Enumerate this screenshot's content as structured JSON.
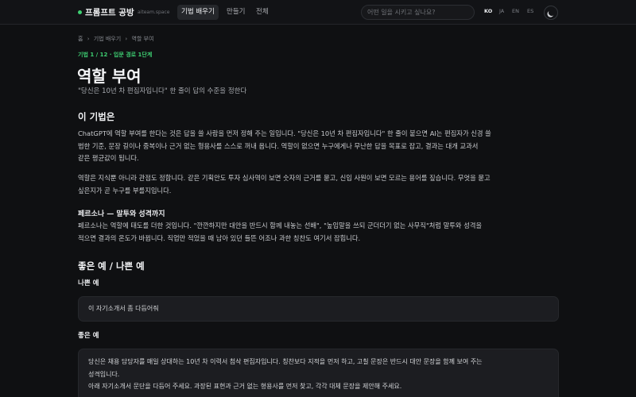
{
  "header": {
    "brand": "프롬프트 공방",
    "domain": "aiteam.space",
    "nav": [
      "기법 배우기",
      "만들기",
      "전체"
    ],
    "active_nav": "기법 배우기",
    "search_placeholder": "어떤 일을 시키고 싶나요?",
    "languages": [
      "KO",
      "JA",
      "EN",
      "ES"
    ],
    "active_language": "KO"
  },
  "breadcrumb": [
    "홈",
    "›",
    "기법 배우기",
    "›",
    "역할 부여"
  ],
  "meta": "기법 1 / 12 · 입문 경로 1단계",
  "title": "역할 부여",
  "subtitle": "\"당신은 10년 차 편집자입니다\" 한 줄이 답의 수준을 정한다",
  "section1": {
    "heading": "이 기법은",
    "para1": [
      "ChatGPT에 역할 부여를 한다는 것은 답을 쓸 사람을 먼저 정해 주는 일입니다. \"당신은 10년 차 편집자입니다\" 한 줄이 붙으면 AI는 편집자가 신경 쓸",
      "법한 기준, 문장 길이나 중복이나 근거 없는 형용사를 스스로 꺼내 옵니다. 역할이 없으면 누구에게나 무난한 답을 목표로 잡고, 결과는 대개 교과서",
      "같은 평균값이 됩니다."
    ],
    "para2": [
      "역할은 지식뿐 아니라 관점도 정합니다. 같은 기획안도 투자 심사역이 보면 숫자의 근거를 묻고, 신입 사원이 보면 모르는 용어를 짚습니다. 무엇을 묻고",
      "싶은지가 곧 누구를 부를지입니다."
    ],
    "subheading": "페르소나 — 말투와 성격까지",
    "para3": [
      "페르소나는 역할에 태도를 더한 것입니다. \"깐깐하지만 대안을 반드시 함께 내놓는 선배\", \"높임말을 쓰되 군더더기 없는 사무직\"처럼 말투와 성격을",
      "적으면 결과의 온도가 바뀝니다. 직업만 적었을 때 남아 있던 들뜬 어조나 과한 칭찬도 여기서 잡힙니다."
    ]
  },
  "section2": {
    "heading": "좋은 예 / 나쁜 예",
    "bad_label": "나쁜 예",
    "bad_example": "이 자기소개서 좀 다듬어줘",
    "good_label": "좋은 예",
    "good_example": [
      "당신은 채용 담당자를 매일 상대하는 10년 차 이력서 첨삭 편집자입니다. 칭찬보다 지적을 먼저 하고, 고칠 문장은 반드시 대안 문장을 함께 보여 주는",
      "성격입니다.",
      "",
      "아래 자기소개서 문단을 다듬어 주세요. 과장된 표현과 근거 없는 형용사를 먼저 찾고, 각각 대체 문장을 제안해 주세요."
    ]
  }
}
